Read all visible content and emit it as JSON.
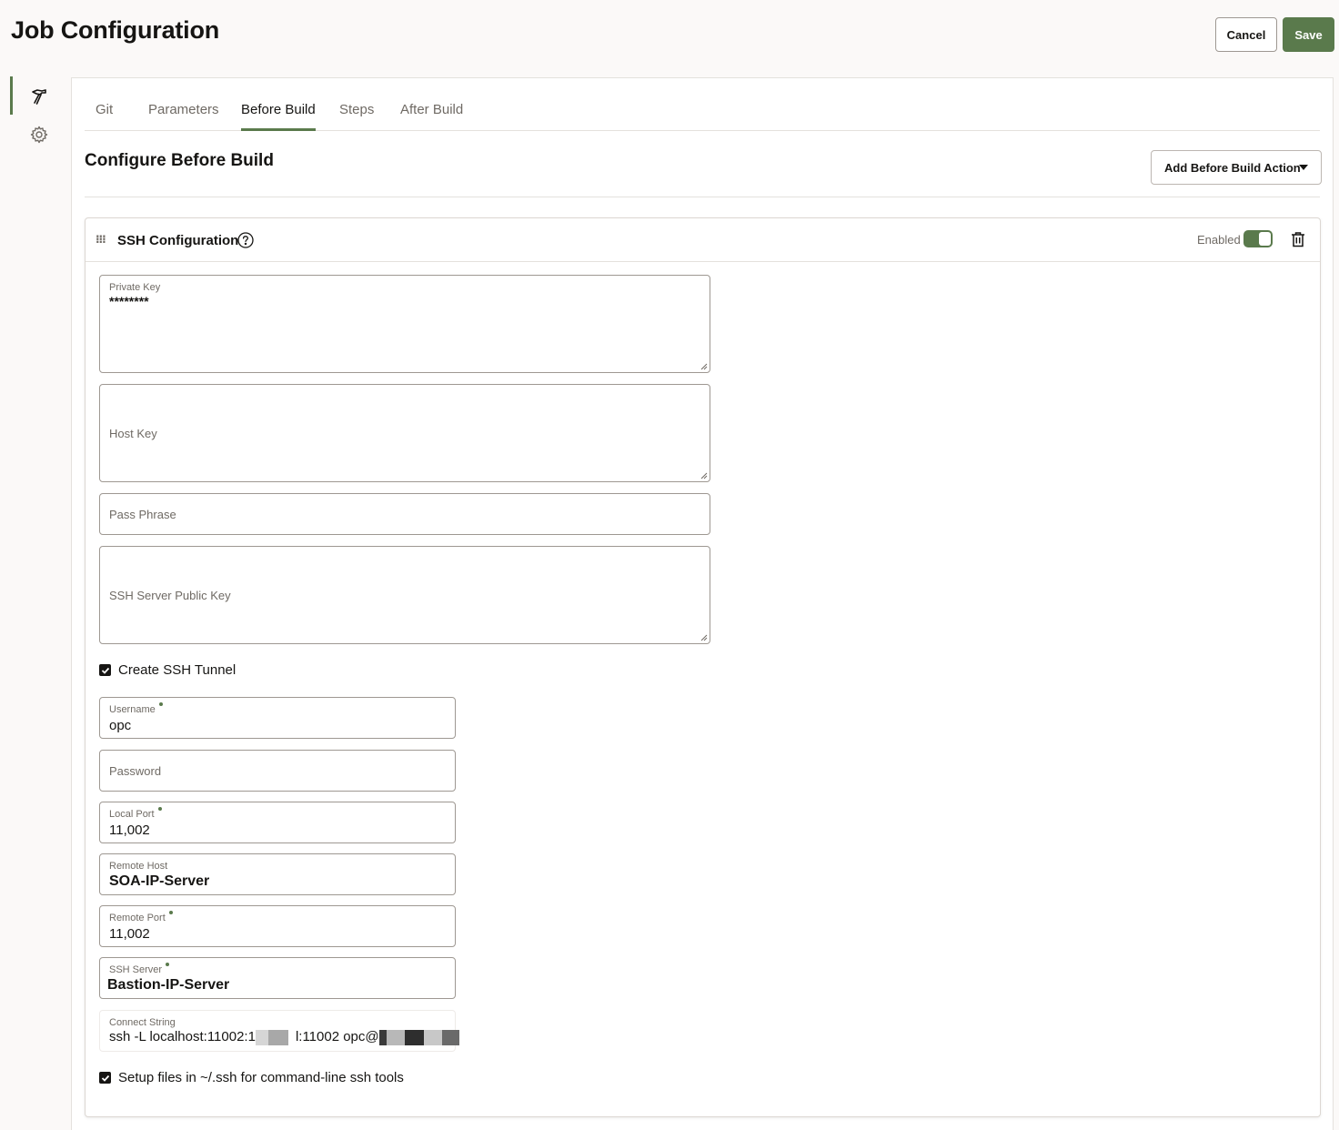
{
  "header": {
    "title": "Job Configuration",
    "cancel_label": "Cancel",
    "save_label": "Save"
  },
  "sidenav": {
    "items": [
      {
        "icon": "hammer-icon",
        "active": true
      },
      {
        "icon": "gear-icon",
        "active": false
      }
    ]
  },
  "tabs": [
    {
      "label": "Git",
      "active": false
    },
    {
      "label": "Parameters",
      "active": false
    },
    {
      "label": "Before Build",
      "active": true
    },
    {
      "label": "Steps",
      "active": false
    },
    {
      "label": "After Build",
      "active": false
    }
  ],
  "section": {
    "title": "Configure Before Build",
    "add_action_label": "Add Before Build Action"
  },
  "card": {
    "title": "SSH Configuration",
    "enabled_label": "Enabled",
    "enabled": true,
    "fields": {
      "private_key": {
        "label": "Private Key",
        "value": "********"
      },
      "host_key": {
        "label": "Host Key"
      },
      "pass_phrase": {
        "label": "Pass Phrase"
      },
      "ssh_server_public_key": {
        "label": "SSH Server Public Key"
      },
      "create_tunnel": {
        "label": "Create SSH Tunnel",
        "checked": true
      },
      "username": {
        "label": "Username",
        "value": "opc"
      },
      "password": {
        "label": "Password"
      },
      "local_port": {
        "label": "Local Port",
        "value": "11,002"
      },
      "remote_host": {
        "label": "Remote Host",
        "value": "SOA-IP-Server"
      },
      "remote_port": {
        "label": "Remote Port",
        "value": "11,002"
      },
      "ssh_server": {
        "label": "SSH Server",
        "value": "Bastion-IP-Server"
      },
      "connect_string": {
        "label": "Connect String",
        "value_prefix": "ssh -L localhost:11002:1",
        "value_middle": "l:11002 opc@"
      },
      "setup_files": {
        "label": "Setup files in ~/.ssh for command-line ssh tools",
        "checked": true
      }
    }
  },
  "colors": {
    "accent": "#5a7a4c",
    "text": "#161513",
    "muted": "#6f6a64",
    "border": "#9e9892"
  }
}
